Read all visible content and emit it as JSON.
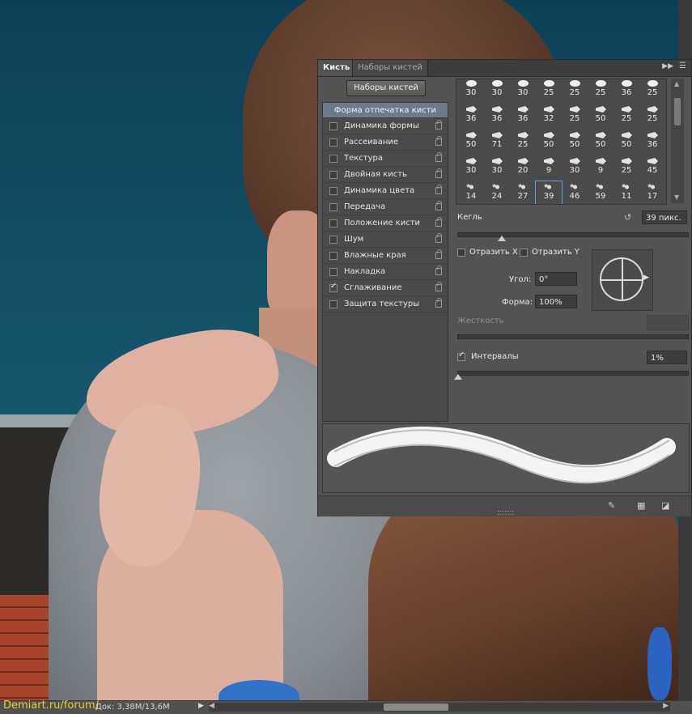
{
  "panel": {
    "tabs": [
      "Кисть",
      "Наборы кистей"
    ],
    "menu_icon": "double-chevron-right-icon",
    "presets_button": "Наборы кистей",
    "options_header": "Форма отпечатка кисти",
    "options": [
      {
        "label": "Динамика формы",
        "checked": false
      },
      {
        "label": "Рассеивание",
        "checked": false
      },
      {
        "label": "Текстура",
        "checked": false
      },
      {
        "label": "Двойная кисть",
        "checked": false
      },
      {
        "label": "Динамика цвета",
        "checked": false
      },
      {
        "label": "Передача",
        "checked": false
      },
      {
        "label": "Положение кисти",
        "checked": false
      },
      {
        "label": "Шум",
        "checked": false
      },
      {
        "label": "Влажные края",
        "checked": false
      },
      {
        "label": "Накладка",
        "checked": false
      },
      {
        "label": "Сглаживание",
        "checked": true
      },
      {
        "label": "Защита текстуры",
        "checked": false
      }
    ],
    "tips": [
      [
        "30",
        "30",
        "30",
        "25",
        "25",
        "25",
        "36",
        "25"
      ],
      [
        "36",
        "36",
        "36",
        "32",
        "25",
        "50",
        "25",
        "25"
      ],
      [
        "50",
        "71",
        "25",
        "50",
        "50",
        "50",
        "50",
        "36"
      ],
      [
        "30",
        "30",
        "20",
        "9",
        "30",
        "9",
        "25",
        "45"
      ],
      [
        "14",
        "24",
        "27",
        "39",
        "46",
        "59",
        "11",
        "17"
      ]
    ],
    "selected_tip": "39",
    "size_label": "Кегль",
    "size_value": "39 пикс.",
    "size_slider_fraction": 0.19,
    "flip_x_label": "Отразить X",
    "flip_y_label": "Отразить Y",
    "flip_x_checked": false,
    "flip_y_checked": false,
    "angle_label": "Угол:",
    "angle_value": "0°",
    "roundness_label": "Форма:",
    "roundness_value": "100%",
    "hardness_label": "Жесткость",
    "spacing_label": "Интервалы",
    "spacing_checked": true,
    "spacing_value": "1%",
    "spacing_slider_fraction": 0.0,
    "bottom_icons": [
      "brush-toggle-icon",
      "grid-icon",
      "new-preset-icon"
    ]
  },
  "statusbar": {
    "watermark": "Demiart.ru/forum/",
    "doc_info": "Док: 3,38M/13,6M"
  }
}
